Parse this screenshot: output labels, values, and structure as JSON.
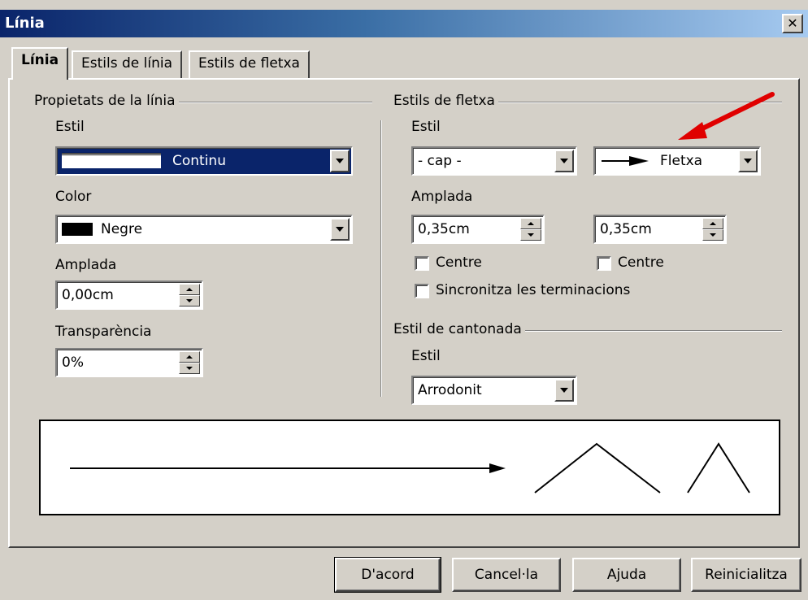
{
  "window": {
    "title": "Línia"
  },
  "tabs": [
    {
      "label": "Línia"
    },
    {
      "label": "Estils de línia"
    },
    {
      "label": "Estils de fletxa"
    }
  ],
  "line_properties": {
    "group_title": "Propietats de la línia",
    "style_label": "Estil",
    "style_value": "Continu",
    "color_label": "Color",
    "color_value": "Negre",
    "color_swatch": "#000000",
    "width_label": "Amplada",
    "width_value": "0,00cm",
    "transparency_label": "Transparència",
    "transparency_value": "0%"
  },
  "arrow_styles": {
    "group_title": "Estils de fletxa",
    "style_label": "Estil",
    "start_style": "- cap -",
    "end_style": "Fletxa",
    "width_label": "Amplada",
    "start_width": "0,35cm",
    "end_width": "0,35cm",
    "center_label_start": "Centre",
    "center_label_end": "Centre",
    "sync_label": "Sincronitza les terminacions"
  },
  "corner_style": {
    "group_title": "Estil de cantonada",
    "style_label": "Estil",
    "style_value": "Arrodonit"
  },
  "buttons": {
    "ok": "D'acord",
    "cancel": "Cancel·la",
    "help": "Ajuda",
    "reset": "Reinicialitza"
  },
  "annotation": {
    "color": "#e00000",
    "icon": "red-arrow-pointer"
  },
  "colors": {
    "titlebar_start": "#0a246a",
    "selection": "#0a246a",
    "face": "#d4d0c8"
  }
}
